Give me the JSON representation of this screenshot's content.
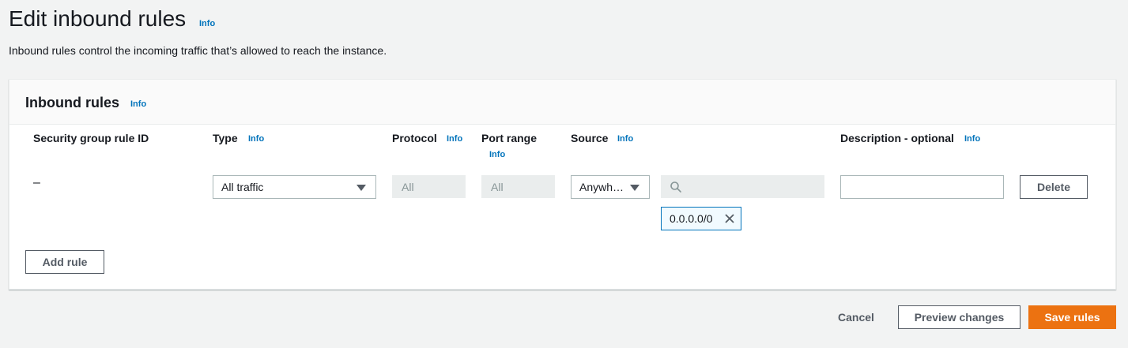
{
  "page": {
    "title": "Edit inbound rules",
    "info_label": "Info",
    "description": "Inbound rules control the incoming traffic that’s allowed to reach the instance."
  },
  "panel": {
    "title": "Inbound rules",
    "info_label": "Info",
    "columns": {
      "rule_id": "Security group rule ID",
      "type": "Type",
      "protocol": "Protocol",
      "port_range": "Port range",
      "source": "Source",
      "description": "Description - optional"
    },
    "column_info_label": "Info",
    "rows": [
      {
        "rule_id": "–",
        "type": "All traffic",
        "protocol": "All",
        "port_range": "All",
        "source": "Anywh…",
        "source_search_value": "",
        "cidr_token": "0.0.0.0/0",
        "description_value": "",
        "delete_label": "Delete"
      }
    ],
    "add_rule_label": "Add rule"
  },
  "footer": {
    "cancel_label": "Cancel",
    "preview_label": "Preview changes",
    "save_label": "Save rules"
  },
  "colors": {
    "accent": "#ec7211",
    "link": "#0073bb",
    "token_border": "#0073bb"
  },
  "icons": {
    "search": "search-icon",
    "token_remove": "close-icon",
    "dropdown": "caret-down-icon"
  }
}
